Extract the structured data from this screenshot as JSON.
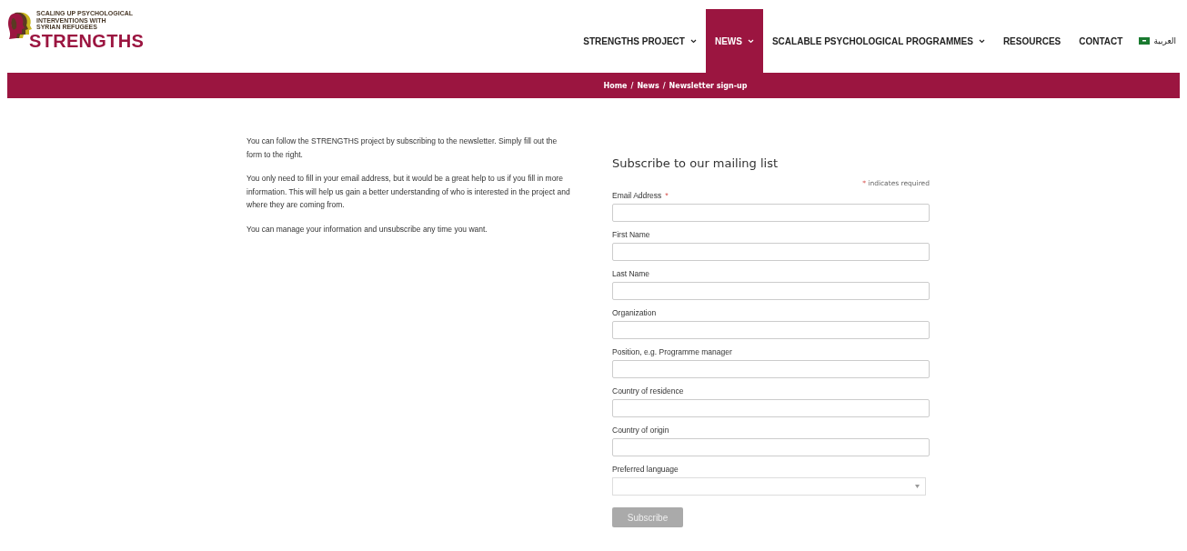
{
  "logo": {
    "tagline": [
      "SCALING UP PSYCHOLOGICAL",
      "INTERVENTIONS WITH",
      "SYRIAN REFUGEES"
    ],
    "name": "STRENGTHS"
  },
  "nav": [
    {
      "label": "STRENGTHS PROJECT",
      "dropdown": true,
      "selected": false
    },
    {
      "label": "NEWS",
      "dropdown": true,
      "selected": true
    },
    {
      "label": "SCALABLE PSYCHOLOGICAL PROGRAMMES",
      "dropdown": true,
      "selected": false
    },
    {
      "label": "RESOURCES",
      "dropdown": false,
      "selected": false
    },
    {
      "label": "CONTACT",
      "dropdown": false,
      "selected": false
    }
  ],
  "language": {
    "label": "العربية"
  },
  "breadcrumb": [
    "Home",
    "News",
    "Newsletter sign-up"
  ],
  "breadcrumb_separator": "/",
  "intro": [
    "You can follow the STRENGTHS project by subscribing to the newsletter. Simply fill out the form to the right.",
    "You only need to fill in your email address, but it would be a great help to us if you fill in more information. This will help us gain a better understanding of who is interested in the project and where they are coming from.",
    "You can manage your information and unsubscribe any time you want."
  ],
  "form": {
    "title": "Subscribe to our mailing list",
    "required_note": "indicates required",
    "required_mark": "*",
    "fields": [
      {
        "label": "Email Address",
        "kind": "text",
        "required": true
      },
      {
        "label": "First Name",
        "kind": "text",
        "required": false
      },
      {
        "label": "Last Name",
        "kind": "text",
        "required": false
      },
      {
        "label": "Organization",
        "kind": "text",
        "required": false
      },
      {
        "label": "Position, e.g. Programme manager",
        "kind": "text",
        "required": false
      },
      {
        "label": "Country of residence",
        "kind": "text",
        "required": false
      },
      {
        "label": "Country of origin",
        "kind": "text",
        "required": false
      },
      {
        "label": "Preferred language",
        "kind": "select",
        "required": false
      }
    ],
    "button": "Subscribe"
  }
}
